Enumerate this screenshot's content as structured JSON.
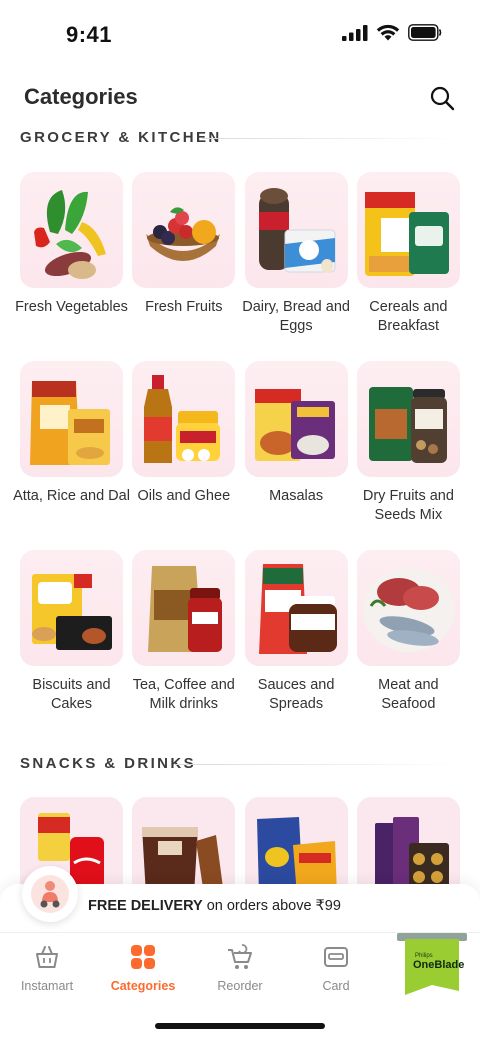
{
  "status_bar": {
    "time": "9:41"
  },
  "header": {
    "title": "Categories",
    "search_icon": "search-icon"
  },
  "sections": {
    "grocery": {
      "title": "GROCERY & KITCHEN",
      "items": [
        {
          "label": "Fresh Vegetables"
        },
        {
          "label": "Fresh Fruits"
        },
        {
          "label": "Dairy, Bread and Eggs"
        },
        {
          "label": "Cereals and Breakfast"
        },
        {
          "label": "Atta, Rice and Dal"
        },
        {
          "label": "Oils and Ghee"
        },
        {
          "label": "Masalas"
        },
        {
          "label": "Dry Fruits and Seeds Mix"
        },
        {
          "label": "Biscuits and Cakes"
        },
        {
          "label": "Tea, Coffee and Milk drinks"
        },
        {
          "label": "Sauces and Spreads"
        },
        {
          "label": "Meat and Seafood"
        }
      ]
    },
    "snacks": {
      "title": "SNACKS & DRINKS"
    }
  },
  "delivery_banner": {
    "bold": "FREE DELIVERY",
    "rest": " on orders above ₹99"
  },
  "bottom_nav": {
    "items": [
      {
        "label": "Instamart",
        "icon": "basket-icon",
        "active": false
      },
      {
        "label": "Categories",
        "icon": "grid-icon",
        "active": true
      },
      {
        "label": "Reorder",
        "icon": "reorder-cart-icon",
        "active": false
      },
      {
        "label": "Card",
        "icon": "card-icon",
        "active": false
      }
    ],
    "ad_text_top": "Philips",
    "ad_text_main": "OneBlade"
  },
  "colors": {
    "accent": "#fc6b2d",
    "tile_bg": "#fbe8ee"
  }
}
